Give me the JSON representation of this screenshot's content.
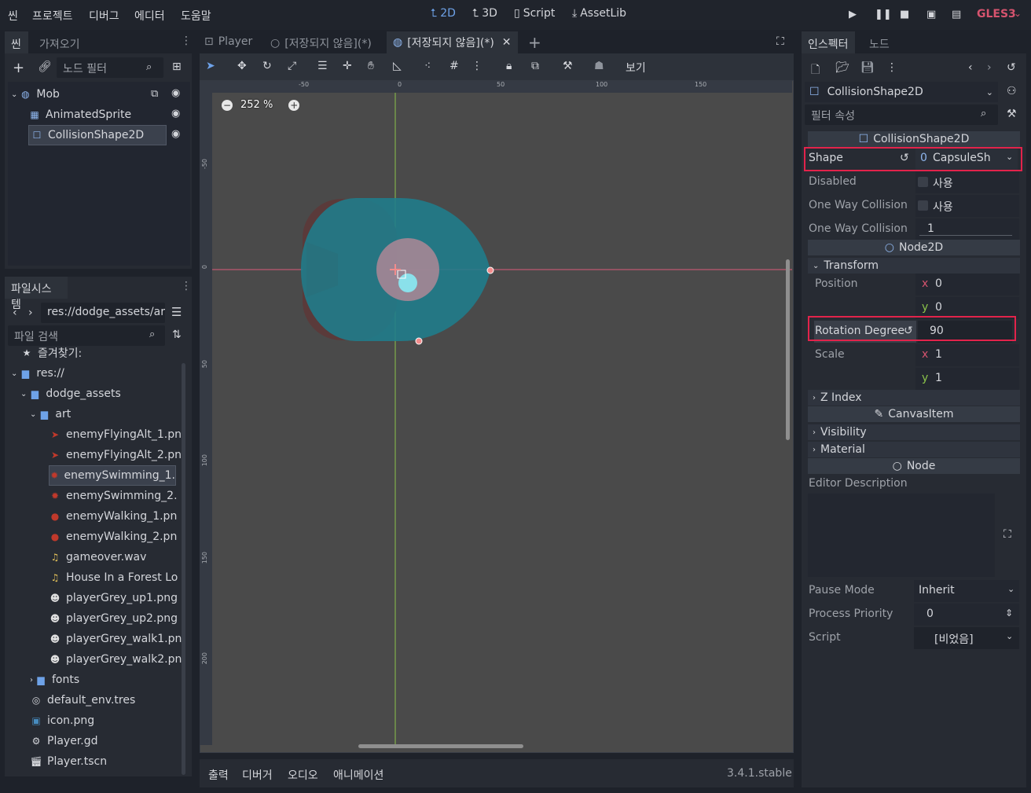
{
  "menubar": {
    "items": [
      "씬",
      "프로젝트",
      "디버그",
      "에디터",
      "도움말"
    ],
    "workspaces": {
      "w2d": "2D",
      "w3d": "3D",
      "script": "Script",
      "assetlib": "AssetLib"
    },
    "renderer": "GLES3"
  },
  "scene_dock": {
    "tabs": {
      "scene": "씬",
      "import": "가져오기"
    },
    "filter_placeholder": "노드 필터",
    "nodes": {
      "root": "Mob",
      "child1": "AnimatedSprite",
      "child2": "CollisionShape2D"
    }
  },
  "filesystem_dock": {
    "title": "파일시스템",
    "path": "res://dodge_assets/art",
    "search_placeholder": "파일 검색",
    "favorites": "즐겨찾기:",
    "items": {
      "res": "res://",
      "dodge_assets": "dodge_assets",
      "art": "art",
      "f1": "enemyFlyingAlt_1.pn",
      "f2": "enemyFlyingAlt_2.pn",
      "f3": "enemySwimming_1.",
      "f4": "enemySwimming_2.",
      "f5": "enemyWalking_1.pn",
      "f6": "enemyWalking_2.pn",
      "f7": "gameover.wav",
      "f8": "House In a Forest Lo",
      "f9": "playerGrey_up1.png",
      "f10": "playerGrey_up2.png",
      "f11": "playerGrey_walk1.pn",
      "f12": "playerGrey_walk2.pn",
      "fonts": "fonts",
      "env": "default_env.tres",
      "icon": "icon.png",
      "playergd": "Player.gd",
      "playertscn": "Player.tscn"
    }
  },
  "editor_tabs": {
    "t1": "Player",
    "t2": "[저장되지 않음](*)",
    "t3": "[저장되지 않음](*)"
  },
  "toolbar": {
    "view": "보기"
  },
  "viewport": {
    "zoom": "252 %",
    "ruler_top": [
      "-50",
      "0",
      "50",
      "100",
      "150"
    ],
    "ruler_left": [
      "-50",
      "0",
      "50",
      "100",
      "150",
      "200"
    ]
  },
  "bottom_panel": {
    "tabs": {
      "output": "출력",
      "debugger": "디버거",
      "audio": "오디오",
      "animation": "애니메이션"
    },
    "version": "3.4.1.stable"
  },
  "inspector": {
    "tabs": {
      "inspector": "인스펙터",
      "node": "노드"
    },
    "object": "CollisionShape2D",
    "filter_placeholder": "필터 속성",
    "sections": {
      "collision": "CollisionShape2D",
      "node2d": "Node2D",
      "canvas": "CanvasItem",
      "node": "Node"
    },
    "props": {
      "shape": {
        "name": "Shape",
        "value": "CapsuleSh"
      },
      "disabled": {
        "name": "Disabled",
        "value": "사용"
      },
      "one_way": {
        "name": "One Way Collision",
        "value": "사용"
      },
      "one_way_margin": {
        "name": "One Way Collision",
        "value": "1"
      },
      "transform": "Transform",
      "position": {
        "name": "Position",
        "x_label": "x",
        "x": "0",
        "y_label": "y",
        "y": "0"
      },
      "rotation": {
        "name": "Rotation Degree",
        "value": "90"
      },
      "scale": {
        "name": "Scale",
        "x_label": "x",
        "x": "1",
        "y_label": "y",
        "y": "1"
      },
      "z_index": "Z Index",
      "visibility": "Visibility",
      "material": "Material",
      "editor_description": "Editor Description",
      "pause_mode": {
        "name": "Pause Mode",
        "value": "Inherit"
      },
      "process_priority": {
        "name": "Process Priority",
        "value": "0"
      },
      "script": {
        "name": "Script",
        "value": "[비었음]"
      }
    }
  },
  "colors": {
    "accent": "#6ea2e8",
    "highlight_box": "#e2234b",
    "shape_fill": "#1f7d8c",
    "gles": "#d5536e"
  }
}
